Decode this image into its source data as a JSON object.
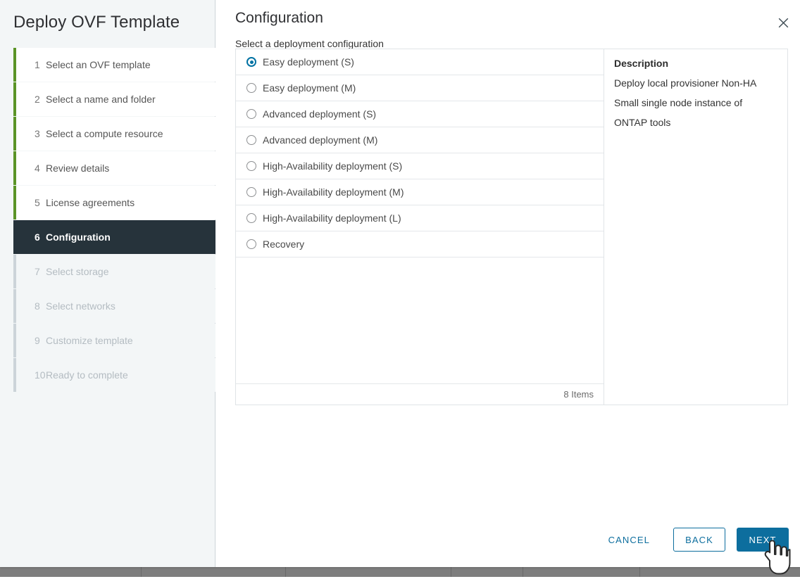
{
  "dialog": {
    "title": "Deploy OVF Template",
    "close_icon": "close-icon"
  },
  "sidebar": {
    "steps": [
      {
        "num": "1",
        "label": "Select an OVF template",
        "state": "done"
      },
      {
        "num": "2",
        "label": "Select a name and folder",
        "state": "done"
      },
      {
        "num": "3",
        "label": "Select a compute resource",
        "state": "done"
      },
      {
        "num": "4",
        "label": "Review details",
        "state": "done"
      },
      {
        "num": "5",
        "label": "License agreements",
        "state": "done"
      },
      {
        "num": "6",
        "label": "Configuration",
        "state": "active"
      },
      {
        "num": "7",
        "label": "Select storage",
        "state": "disabled"
      },
      {
        "num": "8",
        "label": "Select networks",
        "state": "disabled"
      },
      {
        "num": "9",
        "label": "Customize template",
        "state": "disabled"
      },
      {
        "num": "10",
        "label": "Ready to complete",
        "state": "disabled"
      }
    ]
  },
  "page": {
    "title": "Configuration",
    "subtitle": "Select a deployment configuration"
  },
  "options": [
    {
      "label": "Easy deployment (S)",
      "selected": true
    },
    {
      "label": "Easy deployment (M)",
      "selected": false
    },
    {
      "label": "Advanced deployment (S)",
      "selected": false
    },
    {
      "label": "Advanced deployment (M)",
      "selected": false
    },
    {
      "label": "High-Availability deployment (S)",
      "selected": false
    },
    {
      "label": "High-Availability deployment (M)",
      "selected": false
    },
    {
      "label": "High-Availability deployment (L)",
      "selected": false
    },
    {
      "label": "Recovery",
      "selected": false
    }
  ],
  "list_footer": {
    "items_count": "8 Items"
  },
  "description": {
    "title": "Description",
    "lines": [
      "Deploy local provisioner Non-HA",
      "Small single node instance of",
      "ONTAP tools"
    ]
  },
  "footer": {
    "cancel_label": "CANCEL",
    "back_label": "BACK",
    "next_label": "NEXT"
  },
  "colors": {
    "accent_blue": "#0d6e9e",
    "radio_blue": "#0072a3",
    "step_done_bar": "#5b9427",
    "step_active_bg": "#26333b",
    "step_disabled_bar": "#ccd4d9",
    "sidebar_bg": "#f3f6f7",
    "border": "#e0e4e7",
    "taskbar": "#7e7e7e"
  },
  "cursor": {
    "type": "pointer-hand-cursor"
  }
}
